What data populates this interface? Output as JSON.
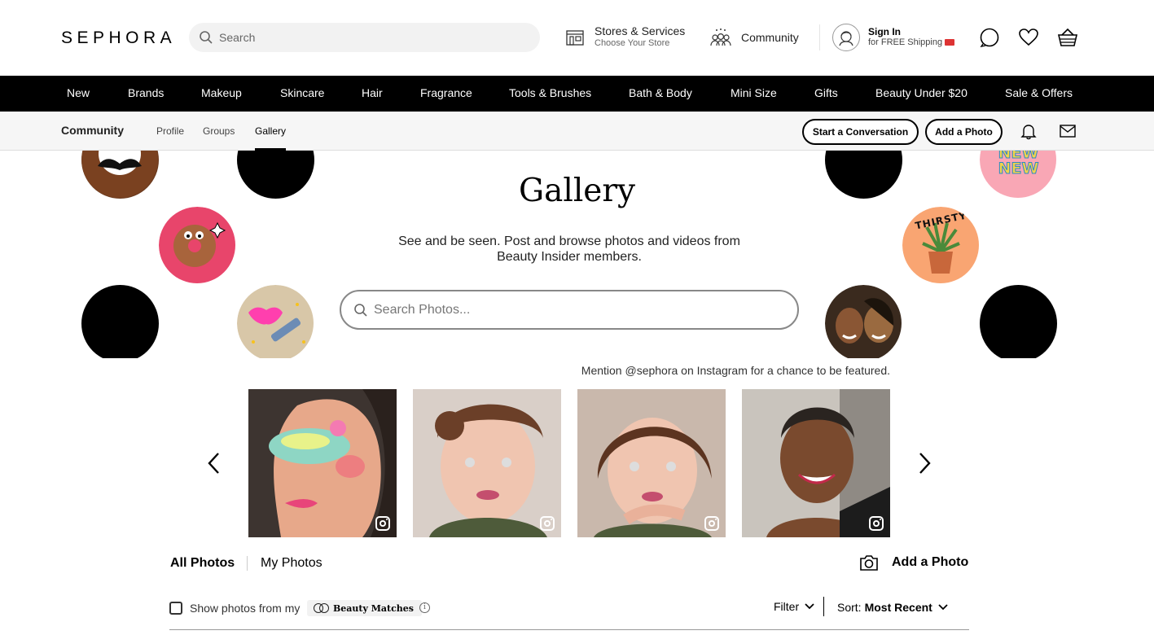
{
  "header": {
    "logo": "SEPHORA",
    "search_placeholder": "Search",
    "stores": {
      "title": "Stores & Services",
      "subtitle": "Choose Your Store"
    },
    "community": "Community",
    "signin": {
      "title": "Sign In",
      "subtitle": "for FREE Shipping"
    }
  },
  "nav": {
    "items": [
      "New",
      "Brands",
      "Makeup",
      "Skincare",
      "Hair",
      "Fragrance",
      "Tools & Brushes",
      "Bath & Body",
      "Mini Size",
      "Gifts",
      "Beauty Under $20",
      "Sale & Offers"
    ]
  },
  "subnav": {
    "title": "Community",
    "tabs": [
      "Profile",
      "Groups",
      "Gallery"
    ],
    "active_tab": "Gallery",
    "start_conversation": "Start a Conversation",
    "add_photo": "Add a Photo"
  },
  "hero": {
    "title": "Gallery",
    "subtitle_line1": "See and be seen. Post and browse photos and videos from",
    "subtitle_line2": "Beauty Insider members.",
    "search_placeholder": "Search Photos...",
    "sticker_new_1": "NEW",
    "sticker_new_2": "NEW",
    "sticker_thirsty": "THIRSTY"
  },
  "mention": "Mention @sephora on Instagram for a chance to be featured.",
  "photo_tabs": {
    "all": "All Photos",
    "mine": "My Photos",
    "add_photo": "Add a Photo"
  },
  "filters": {
    "show_label": "Show photos from my",
    "beauty_matches": "Beauty Matches",
    "filter": "Filter",
    "sort_label": "Sort:",
    "sort_value": "Most Recent"
  },
  "colors": {
    "nav_bg": "#000000",
    "subnav_bg": "#f6f6f6",
    "search_bg": "#f2f2f2",
    "accent_pink": "#e8456b"
  }
}
